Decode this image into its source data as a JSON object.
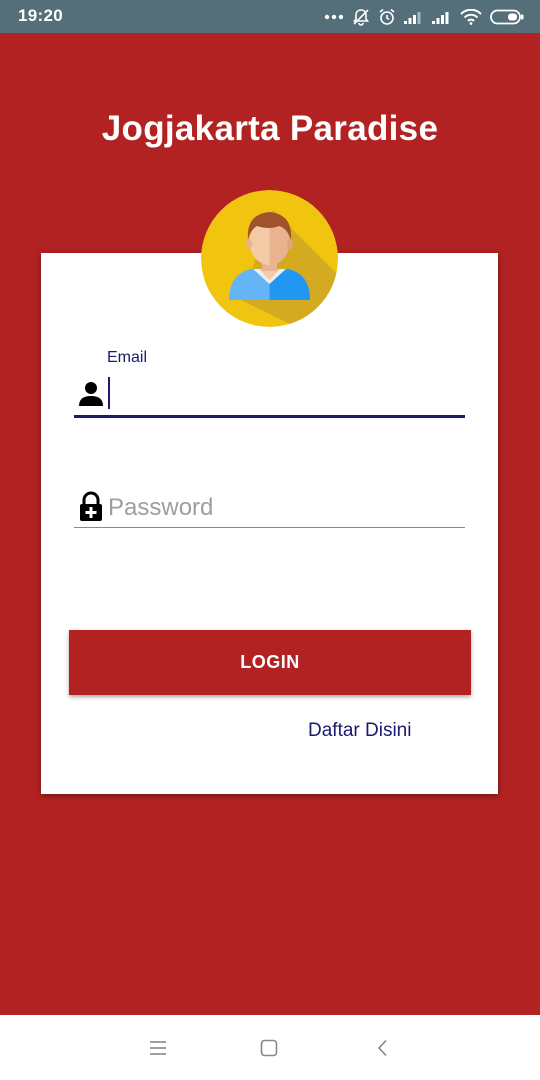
{
  "status_bar": {
    "time": "19:20",
    "icons": [
      "more-dots-icon",
      "notifications-off-icon",
      "alarm-icon",
      "signal-icon",
      "signal-icon",
      "wifi-icon",
      "battery-icon"
    ]
  },
  "app": {
    "title": "Jogjakarta Paradise"
  },
  "login_form": {
    "email_label": "Email",
    "email_value": "",
    "password_placeholder": "Password",
    "login_button": "LOGIN",
    "register_link": "Daftar Disini"
  },
  "nav_bar": {
    "buttons": [
      "menu-icon",
      "home-icon",
      "back-icon"
    ]
  },
  "colors": {
    "primary": "#b22222",
    "status_bar": "#546e7a",
    "accent_text": "#1a1a6e",
    "avatar_bg": "#f1c40f"
  }
}
